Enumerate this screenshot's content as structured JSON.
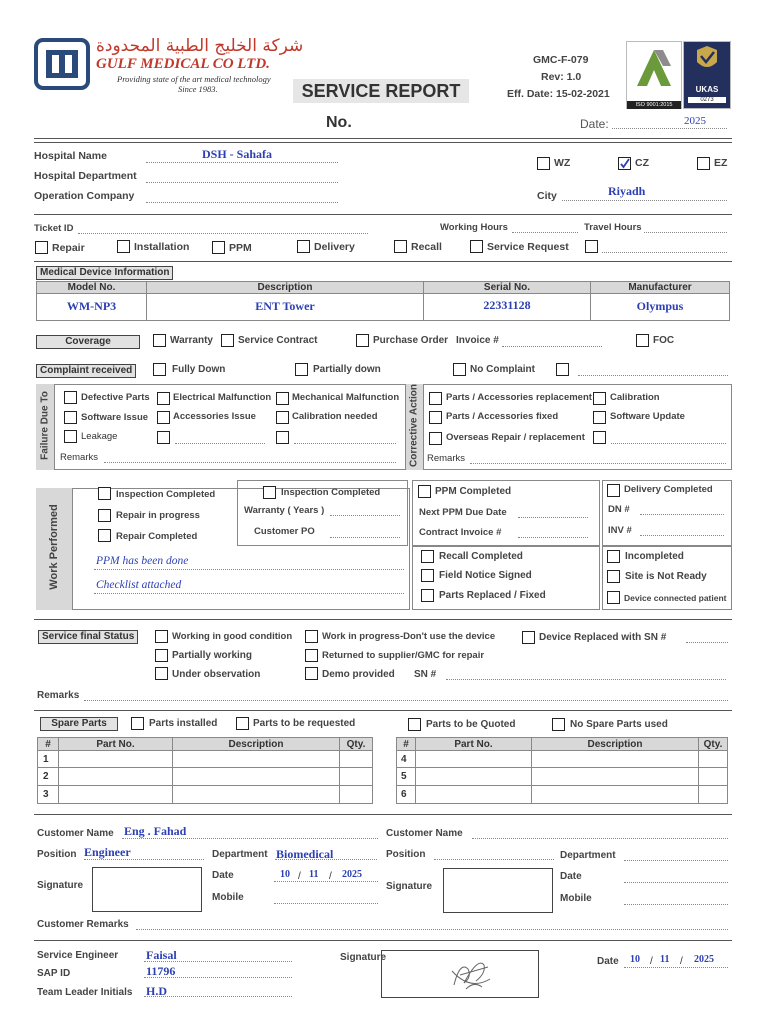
{
  "company": {
    "arabic_name": "شركة الخليج الطبية المحدودة",
    "english_name": "GULF MEDICAL CO LTD.",
    "tagline": "Providing state of the art medical technology",
    "since": "Since 1983."
  },
  "form": {
    "title": "SERVICE REPORT",
    "code": "GMC-F-079",
    "rev": "Rev: 1.0",
    "eff_date": "Eff. Date: 15-02-2021",
    "no_label": "No.",
    "date_label": "Date:",
    "date_year": "2025"
  },
  "badges": {
    "iso": "ISO 9001:2015",
    "ukas": "UKAS",
    "ukas_code": "0273"
  },
  "header": {
    "hospital_name_label": "Hospital Name",
    "hospital_name": "DSH - Sahafa",
    "hospital_dept_label": "Hospital Department",
    "operation_company_label": "Operation Company",
    "wz": "WZ",
    "cz": "CZ",
    "ez": "EZ",
    "city_label": "City",
    "city": "Riyadh"
  },
  "ticket": {
    "ticket_id_label": "Ticket ID",
    "working_hours_label": "Working Hours",
    "travel_hours_label": "Travel Hours",
    "types": [
      "Repair",
      "Installation",
      "PPM",
      "Delivery",
      "Recall",
      "Service Request"
    ]
  },
  "device": {
    "section_label": "Medical Device Information",
    "headers": [
      "Model No.",
      "Description",
      "Serial No.",
      "Manufacturer"
    ],
    "values": [
      "WM-NP3",
      "ENT Tower",
      "22331128",
      "Olympus"
    ]
  },
  "coverage": {
    "label": "Coverage",
    "options": [
      "Warranty",
      "Service Contract",
      "Purchase Order",
      "Invoice #",
      "FOC"
    ]
  },
  "complaint": {
    "label": "Complaint received",
    "options": [
      "Fully Down",
      "Partially down",
      "No Complaint"
    ]
  },
  "failure": {
    "label": "Failure Due To",
    "col1": [
      "Defective Parts",
      "Software Issue",
      "Leakage"
    ],
    "col2": [
      "Electrical Malfunction",
      "Accessories Issue"
    ],
    "col3": [
      "Mechanical Malfunction",
      "Calibration needed"
    ],
    "remarks": "Remarks"
  },
  "corrective": {
    "label": "Corrective Action",
    "col1": [
      "Parts / Accessories replacement",
      "Parts / Accessories fixed",
      "Overseas Repair / replacement"
    ],
    "col2": [
      "Calibration",
      "Software Update"
    ],
    "remarks": "Remarks"
  },
  "work": {
    "label": "Work Performed",
    "left": [
      "Inspection Completed",
      "Repair in progress",
      "Repair Completed"
    ],
    "note1": "PPM has been done",
    "note2": "Checklist attached",
    "mid_title": "Inspection Completed",
    "warranty_years": "Warranty ( Years )",
    "customer_po": "Customer PO",
    "ppm_completed": "PPM Completed",
    "next_ppm": "Next PPM Due Date",
    "contract_invoice": "Contract Invoice #",
    "recall_completed": "Recall Completed",
    "field_notice": "Field Notice Signed",
    "parts_replaced": "Parts Replaced / Fixed",
    "delivery_completed": "Delivery Completed",
    "dn": "DN  #",
    "inv": "INV #",
    "incompleted": "Incompleted",
    "site_not_ready": "Site is Not Ready",
    "device_connected": "Device connected patient"
  },
  "final_status": {
    "label": "Service final Status",
    "col1": [
      "Working in good condition",
      "Partially working",
      "Under observation"
    ],
    "col2": [
      "Work in progress-Don't use the device",
      "Returned to supplier/GMC for repair",
      "Demo provided"
    ],
    "sn": "SN #",
    "replaced": "Device Replaced with SN #",
    "remarks": "Remarks"
  },
  "spare": {
    "label": "Spare Parts",
    "options": [
      "Parts installed",
      "Parts to be requested",
      "Parts to be Quoted",
      "No Spare Parts used"
    ],
    "headers": [
      "#",
      "Part No.",
      "Description",
      "Qty."
    ],
    "left_rows": [
      "1",
      "2",
      "3"
    ],
    "right_rows": [
      "4",
      "5",
      "6"
    ]
  },
  "customer": {
    "name_label": "Customer Name",
    "name": "Eng . Fahad",
    "position_label": "Position",
    "position": "Engineer",
    "department_label": "Department",
    "department": "Biomedical",
    "signature_label": "Signature",
    "date_label": "Date",
    "date_d": "10",
    "date_m": "11",
    "date_y": "2025",
    "mobile_label": "Mobile",
    "remarks_label": "Customer Remarks"
  },
  "engineer": {
    "service_engineer_label": "Service Engineer",
    "service_engineer": "Faisal",
    "sap_label": "SAP ID",
    "sap": "11796",
    "tl_label": "Team Leader Initials",
    "tl": "H.D",
    "signature_label": "Signature",
    "date_label": "Date",
    "date_d": "10",
    "date_m": "11",
    "date_y": "2025"
  },
  "colors": {
    "handwriting": "#2c3fb3",
    "brand_red": "#c0392b",
    "section_bg": "#e2e2e2"
  }
}
